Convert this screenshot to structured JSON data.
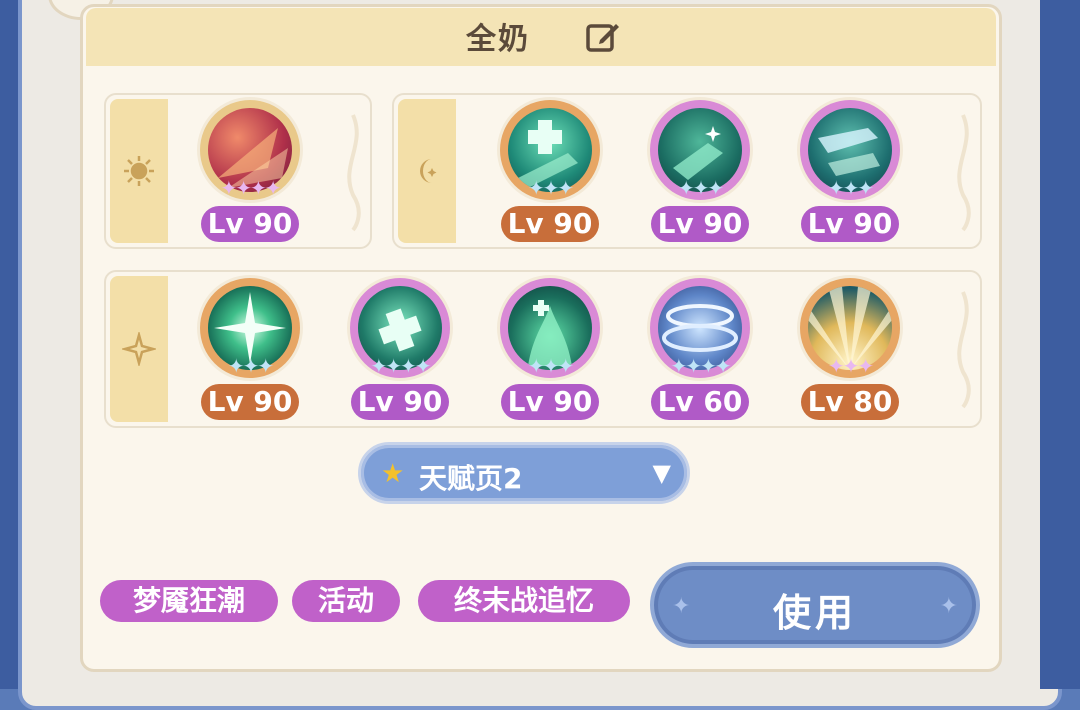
{
  "header": {
    "title": "全奶"
  },
  "row_sun": {
    "skills": [
      {
        "level": "Lv 90",
        "stars": "✦✦✦✦",
        "color": "purple",
        "star_color": "#e8b8f0"
      }
    ]
  },
  "row_moon": {
    "skills": [
      {
        "level": "Lv 90",
        "stars": "✦✦✦",
        "color": "orange",
        "star_color": "#bfe4f6"
      },
      {
        "level": "Lv 90",
        "stars": "✦✦✦",
        "color": "purple",
        "star_color": "#bfe4f6"
      },
      {
        "level": "Lv 90",
        "stars": "✦✦✦",
        "color": "purple",
        "star_color": "#bfe4f6"
      }
    ]
  },
  "row_spark": {
    "skills": [
      {
        "level": "Lv 90",
        "stars": "✦✦✦",
        "color": "orange",
        "star_color": "#bfe4f6"
      },
      {
        "level": "Lv 90",
        "stars": "✦✦✦✦",
        "color": "purple",
        "star_color": "#bfe4f6"
      },
      {
        "level": "Lv 90",
        "stars": "✦✦✦",
        "color": "purple",
        "star_color": "#bfe4f6"
      },
      {
        "level": "Lv 60",
        "stars": "✦✦✦✦",
        "color": "purple",
        "star_color": "#bfe4f6"
      },
      {
        "level": "Lv 80",
        "stars": "✦✦✦",
        "color": "orange",
        "star_color": "#e8b8f0"
      }
    ]
  },
  "dropdown": {
    "label": "天赋页2"
  },
  "tags": [
    "梦魇狂潮",
    "活动",
    "终末战追忆"
  ],
  "use_button": {
    "label": "使用"
  },
  "colors": {
    "purple": "#b05ac7",
    "orange": "#c86e3a",
    "accent_blue": "#7e9fd8"
  }
}
